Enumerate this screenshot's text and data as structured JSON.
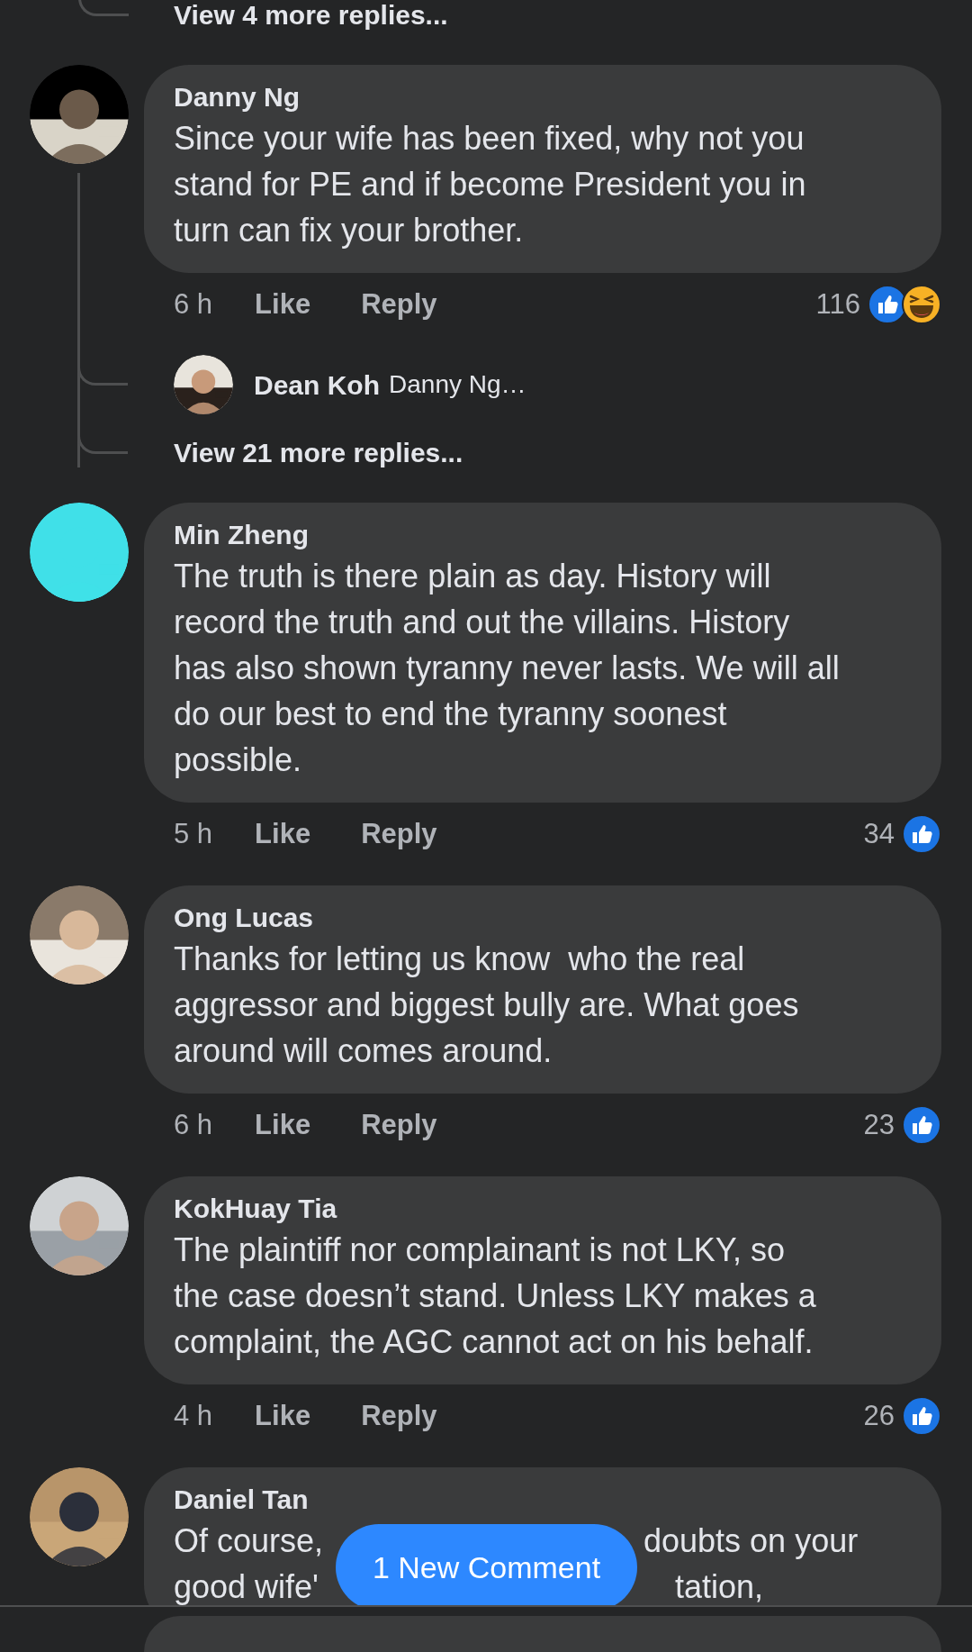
{
  "earlier_thread": {
    "view_more": "View 4 more replies..."
  },
  "comments": [
    {
      "name": "Danny Ng",
      "lines": [
        "Since your wife has been fixed, why not you",
        "stand for PE and if become President you in",
        "turn can fix your brother."
      ],
      "time": "6 h",
      "like": "Like",
      "reply": "Reply",
      "count": "116",
      "reactions": [
        {
          "kind": "like"
        },
        {
          "kind": "haha"
        }
      ],
      "replies": [
        {
          "name": "Dean Koh",
          "text": "Danny Ng…"
        }
      ],
      "view_more": "View 21 more replies..."
    },
    {
      "name": "Min Zheng",
      "lines": [
        "The truth is there plain as day. History will",
        "record the truth and out the villains. History",
        "has also shown tyranny never lasts. We will all",
        "do our best to end the tyranny soonest",
        "possible."
      ],
      "time": "5 h",
      "like": "Like",
      "reply": "Reply",
      "count": "34",
      "reactions": [
        {
          "kind": "like"
        }
      ]
    },
    {
      "name": "Ong Lucas",
      "lines": [
        "Thanks for letting us know  who the real",
        "aggressor and biggest bully are. What goes",
        "around will comes around."
      ],
      "time": "6 h",
      "like": "Like",
      "reply": "Reply",
      "count": "23",
      "reactions": [
        {
          "kind": "like"
        }
      ]
    },
    {
      "name": "KokHuay Tia",
      "lines": [
        "The plaintiff nor complainant is not LKY, so",
        "the case doesn’t stand. Unless LKY makes a",
        "complaint, the AGC cannot act on his behalf."
      ],
      "time": "4 h",
      "like": "Like",
      "reply": "Reply",
      "count": "26",
      "reactions": [
        {
          "kind": "like"
        }
      ]
    },
    {
      "name": "Daniel Tan",
      "partial_lines": [
        [
          "Of course,",
          "doubts on your"
        ],
        [
          "good wife'",
          "tation,"
        ]
      ]
    }
  ],
  "new_comment_button": "1 New Comment"
}
